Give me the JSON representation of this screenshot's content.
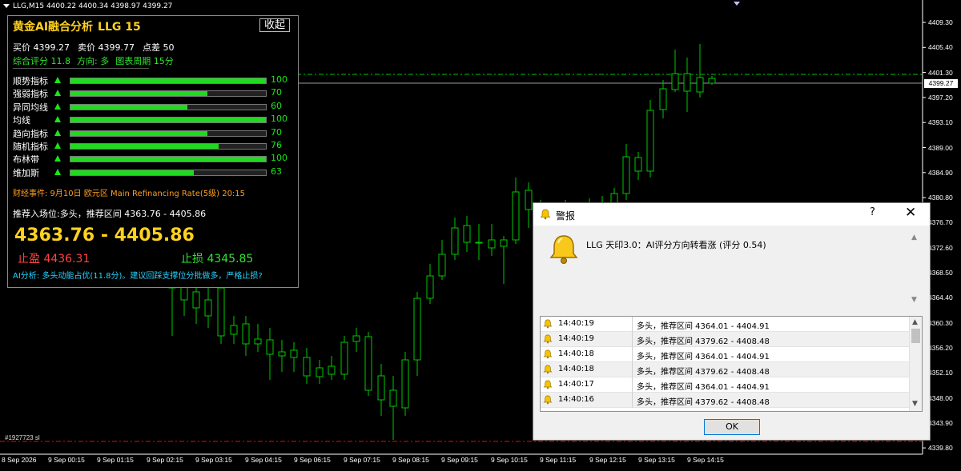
{
  "chart": {
    "symbol_line": "LLG,M15  4400.22 4400.34 4398.97 4399.27",
    "current_price": "4399.27",
    "price_ticks": [
      "4409.30",
      "4405.40",
      "4401.30",
      "4397.20",
      "4393.10",
      "4389.00",
      "4384.90",
      "4380.80",
      "4376.70",
      "4372.60",
      "4368.50",
      "4364.40",
      "4360.30",
      "4356.20",
      "4352.10",
      "4348.00",
      "4343.90",
      "4339.80"
    ],
    "time_ticks": [
      "8 Sep 2026",
      "9 Sep 00:15",
      "9 Sep 01:15",
      "9 Sep 02:15",
      "9 Sep 03:15",
      "9 Sep 04:15",
      "9 Sep 06:15",
      "9 Sep 07:15",
      "9 Sep 08:15",
      "9 Sep 09:15",
      "9 Sep 10:15",
      "9 Sep 11:15",
      "9 Sep 12:15",
      "9 Sep 13:15",
      "9 Sep 14:15"
    ],
    "order_label": "#1927723 sl",
    "colors": {
      "background": "#000000",
      "candle": "#FFFFFF",
      "grid": "#2A2A2A",
      "entry_line": "#00C800",
      "sl_line": "#FF0000"
    }
  },
  "panel": {
    "title": "黄金AI融合分析",
    "title_sub": "LLG 15",
    "collapse_label": "收起",
    "bid": "买价 4399.27",
    "ask": "卖价 4399.77",
    "spread": "点差 50",
    "score": "综合评分 11.8",
    "direction": "方向: 多",
    "timeframe": "图表周期 15分",
    "indicators": [
      {
        "name": "顺势指标",
        "value": 100,
        "value_text": "100",
        "direction": "up"
      },
      {
        "name": "强弱指标",
        "value": 70,
        "value_text": "70",
        "direction": "up"
      },
      {
        "name": "异同均线",
        "value": 60,
        "value_text": "60",
        "direction": "up"
      },
      {
        "name": "均线",
        "value": 100,
        "value_text": "100",
        "direction": "up"
      },
      {
        "name": "趋向指标",
        "value": 70,
        "value_text": "70",
        "direction": "up"
      },
      {
        "name": "随机指标",
        "value": 76,
        "value_text": "76",
        "direction": "up"
      },
      {
        "name": "布林带",
        "value": 100,
        "value_text": "100",
        "direction": "up"
      },
      {
        "name": "维加斯",
        "value": 63,
        "value_text": "63",
        "direction": "up"
      }
    ],
    "event": "财经事件: 9月10日 欧元区 Main Refinancing Rate(5级) 20:15",
    "entry_text": "推荐入场位:多头，推荐区间 4363.76 - 4405.86",
    "big_range": "4363.76 - 4405.86",
    "take_profit": "止盈 4436.31",
    "stop_loss": "止损 4345.85",
    "ai_analysis": "AI分析: 多头动能占优(11.8分)。建议回踩支撑位分批做多，严格止损?",
    "colors": {
      "title": "#FFD21F",
      "green": "#2EE62E",
      "red": "#FF4242",
      "orange": "#FF9E1F",
      "cyan": "#27D3FF"
    }
  },
  "alert": {
    "title": "警报",
    "help": "?",
    "close": "✕",
    "message": "LLG 天印3.0：AI评分方向转看涨 (评分 0.54)",
    "rows": [
      {
        "time": "14:40:19",
        "message": "多头，推荐区间 4364.01 - 4404.91"
      },
      {
        "time": "14:40:19",
        "message": "多头，推荐区间 4379.62 - 4408.48"
      },
      {
        "time": "14:40:18",
        "message": "多头，推荐区间 4364.01 - 4404.91"
      },
      {
        "time": "14:40:18",
        "message": "多头，推荐区间 4379.62 - 4408.48"
      },
      {
        "time": "14:40:17",
        "message": "多头，推荐区间 4364.01 - 4404.91"
      },
      {
        "time": "14:40:16",
        "message": "多头，推荐区间 4379.62 - 4408.48"
      }
    ],
    "ok_label": "OK"
  }
}
